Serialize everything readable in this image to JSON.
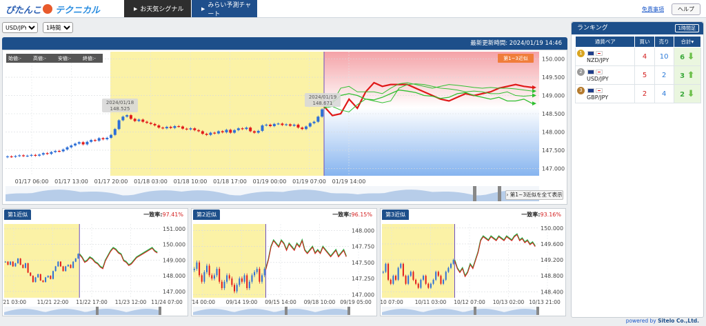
{
  "header": {
    "logo_text_1": "ぴたんこ",
    "logo_text_2": "テクニカル",
    "nav": [
      {
        "label": "お天気シグナル",
        "active": false
      },
      {
        "label": "みらい予測チャート",
        "active": true
      }
    ],
    "disclaimer": "免責事項",
    "help": "ヘルプ"
  },
  "controls": {
    "pair_options": [
      "USD/JPY",
      "NZD/JPY",
      "GBP/JPY"
    ],
    "pair": "USD/JPY",
    "timeframe_options": [
      "1時間足"
    ],
    "timeframe": "1時間足"
  },
  "main_chart": {
    "update_label": "最新更新時間: 2024/01/19 14:46",
    "ohlc": {
      "open": "始値:-",
      "high": "高値:-",
      "low": "安値:-",
      "close": "終値:-"
    },
    "forecast_badge": "第1~3近似",
    "callout_left": {
      "date": "2024/01/18",
      "price": "148.525"
    },
    "callout_right": {
      "date": "2024/01/19",
      "price": "148.671"
    },
    "show_all": "第1~3近似を全て表示",
    "colors": {
      "up": "#2e6fd6",
      "down": "#e11b1b",
      "shade": "#fbf2a6",
      "forecast_red": "#e01818",
      "forecast_green": "#2fbf2f"
    }
  },
  "chart_data": [
    {
      "type": "candlestick",
      "title": "USD/JPY 1時間足",
      "x_ticks": [
        "01/17 06:00",
        "01/17 13:00",
        "01/17 20:00",
        "01/18 03:00",
        "01/18 10:00",
        "01/18 17:00",
        "01/19 00:00",
        "01/19 07:00",
        "01/19 14:00"
      ],
      "y_ticks": [
        "150.000",
        "149.500",
        "149.000",
        "148.500",
        "148.000",
        "147.500",
        "147.000"
      ],
      "ylim": [
        146.8,
        150.2
      ],
      "close": [
        147.33,
        147.32,
        147.34,
        147.36,
        147.34,
        147.35,
        147.37,
        147.35,
        147.38,
        147.42,
        147.4,
        147.45,
        147.48,
        147.47,
        147.52,
        147.58,
        147.63,
        147.68,
        147.72,
        147.66,
        147.73,
        147.78,
        147.76,
        147.83,
        147.8,
        147.84,
        147.92,
        148.08,
        148.32,
        148.42,
        148.46,
        148.36,
        148.3,
        148.34,
        148.28,
        148.25,
        148.22,
        148.18,
        148.12,
        148.1,
        148.14,
        148.11,
        148.16,
        148.15,
        148.09,
        148.07,
        148.1,
        148.05,
        148.02,
        147.95,
        147.92,
        147.98,
        147.96,
        148.02,
        147.99,
        148.06,
        147.98,
        148.05,
        148.1,
        148.08,
        148.12,
        148.02,
        147.98,
        148.03,
        148.18,
        148.2,
        148.16,
        148.22,
        148.23,
        148.19,
        148.21,
        148.17,
        148.2,
        148.12,
        148.08,
        148.15,
        148.24,
        148.28,
        148.42,
        148.62
      ],
      "forecast_series": [
        {
          "values": [
            148.7,
            148.45,
            148.5,
            148.9,
            148.65,
            149.1,
            149.35,
            149.25,
            149.3,
            149.3,
            149.3,
            149.2,
            149.1,
            149.0,
            148.9,
            148.85,
            148.95,
            149.05,
            149.0,
            149.05,
            149.1,
            149.2,
            149.25,
            149.3,
            149.25,
            149.22
          ]
        },
        {
          "values": [
            148.65,
            148.8,
            149.0,
            149.05,
            149.0,
            148.9,
            148.88,
            148.95,
            149.05,
            149.15,
            149.12,
            149.08,
            149.0,
            148.98,
            148.92,
            148.95,
            149.05,
            149.08,
            149.0,
            148.95,
            148.9,
            148.95,
            148.85,
            148.85,
            148.9,
            148.78
          ]
        },
        {
          "values": [
            148.7,
            148.8,
            149.2,
            149.25,
            149.1,
            149.1,
            149.1,
            149.05,
            149.2,
            149.32,
            149.35,
            149.3,
            149.25,
            149.2,
            149.25,
            149.3,
            149.28,
            149.25,
            149.22,
            149.2,
            149.22,
            149.2,
            149.2,
            149.18,
            149.15,
            149.12
          ]
        },
        {
          "values": [
            148.65,
            148.7,
            148.6,
            148.55,
            148.75,
            148.9,
            148.85,
            148.8,
            148.85,
            149.2,
            149.3,
            149.32,
            149.3,
            149.25,
            149.2,
            149.18,
            149.15,
            149.1,
            149.12,
            149.1,
            149.05,
            149.05,
            149.1,
            149.0,
            148.98,
            149.0
          ]
        }
      ]
    },
    {
      "type": "candlestick",
      "title": "第1近似",
      "match_label": "一致率:",
      "match_value": "97.41%",
      "x_ticks": [
        "/21 03:00",
        "11/21 22:00",
        "11/22 17:00",
        "11/23 12:00",
        "11/24 07:00"
      ],
      "y_ticks": [
        "151.000",
        "150.000",
        "149.000",
        "148.000",
        "147.000"
      ],
      "ylim": [
        146.6,
        151.3
      ],
      "close": [
        148.9,
        148.7,
        148.9,
        148.6,
        148.8,
        149.1,
        148.7,
        148.5,
        148.8,
        148.2,
        148.0,
        147.6,
        147.9,
        148.1,
        147.7,
        147.6,
        147.9,
        148.0,
        147.8,
        148.3,
        148.6,
        148.9,
        148.6,
        148.3,
        148.6,
        148.7,
        148.5,
        148.9,
        149.1,
        149.4,
        149.2,
        148.9,
        149.0,
        149.2,
        149.1,
        148.9,
        148.8,
        148.6,
        148.5,
        149.0,
        149.3,
        149.6,
        149.8,
        149.7,
        149.5,
        149.4,
        149.0,
        148.9,
        148.7,
        148.8,
        149.0,
        149.2,
        149.3,
        149.4,
        149.5,
        149.6,
        149.7,
        149.8,
        149.6,
        149.5
      ],
      "shade_until_index": 29
    },
    {
      "type": "candlestick",
      "title": "第2近似",
      "match_label": "一致率:",
      "match_value": "96.15%",
      "x_ticks": [
        "/14 00:00",
        "09/14 19:00",
        "09/15 14:00",
        "09/18 10:00",
        "09/19 05:00"
      ],
      "y_ticks": [
        "148.000",
        "147.750",
        "147.500",
        "147.250",
        "147.000"
      ],
      "ylim": [
        146.95,
        148.1
      ],
      "close": [
        147.4,
        147.5,
        147.3,
        147.2,
        147.35,
        147.45,
        147.3,
        147.25,
        147.3,
        147.4,
        147.2,
        147.1,
        147.2,
        147.3,
        147.25,
        147.15,
        147.05,
        147.15,
        147.25,
        147.2,
        147.3,
        147.1,
        147.2,
        147.3,
        147.35,
        147.4,
        147.2,
        147.3,
        147.4,
        147.55,
        147.75,
        147.85,
        147.8,
        147.75,
        147.85,
        147.8,
        147.7,
        147.8,
        147.75,
        147.7,
        147.8,
        147.75,
        147.85,
        147.7,
        147.65,
        147.7,
        147.75,
        147.65,
        147.7,
        147.65,
        147.75,
        147.7,
        147.65,
        147.6,
        147.65,
        147.7,
        147.6,
        147.65,
        147.7,
        147.6
      ],
      "shade_until_index": 28
    },
    {
      "type": "candlestick",
      "title": "第3近似",
      "match_label": "一致率:",
      "match_value": "93.16%",
      "x_ticks": [
        "10 07:00",
        "10/11 03:00",
        "10/12 07:00",
        "10/13 02:00",
        "10/13 21:00"
      ],
      "y_ticks": [
        "150.000",
        "149.600",
        "149.200",
        "148.800",
        "148.400"
      ],
      "ylim": [
        148.25,
        150.1
      ],
      "close": [
        148.9,
        149.1,
        148.7,
        148.6,
        148.8,
        148.7,
        149.0,
        149.1,
        148.8,
        148.6,
        148.8,
        148.9,
        148.7,
        148.6,
        148.5,
        148.7,
        148.8,
        148.6,
        148.5,
        148.6,
        148.7,
        148.9,
        148.8,
        148.6,
        148.7,
        148.9,
        149.0,
        149.1,
        149.2,
        149.0,
        148.9,
        149.0,
        148.8,
        148.9,
        149.1,
        149.0,
        149.2,
        149.4,
        149.7,
        149.8,
        149.75,
        149.7,
        149.8,
        149.75,
        149.7,
        149.8,
        149.75,
        149.7,
        149.8,
        149.75,
        149.7,
        149.8,
        149.85,
        149.7,
        149.75,
        149.65,
        149.7,
        149.6,
        149.65,
        149.55
      ],
      "shade_until_index": 28
    }
  ],
  "ranking": {
    "title": "ランキング",
    "timeframe_btn": "1時間足",
    "columns": [
      "通貨ペア",
      "買い",
      "売り",
      "合計"
    ],
    "rows": [
      {
        "rank": "1",
        "pair": "NZD/JPY",
        "buy": "4",
        "sell": "10",
        "total": "6",
        "direction": "down",
        "medal": "#d9a521"
      },
      {
        "rank": "2",
        "pair": "USD/JPY",
        "buy": "5",
        "sell": "2",
        "total": "3",
        "direction": "up",
        "medal": "#9a9a9a"
      },
      {
        "rank": "3",
        "pair": "GBP/JPY",
        "buy": "2",
        "sell": "4",
        "total": "2",
        "direction": "down",
        "medal": "#b57b2e"
      }
    ]
  },
  "footer": {
    "powered": "powered by",
    "company": "Sitelo Co.,Ltd."
  }
}
